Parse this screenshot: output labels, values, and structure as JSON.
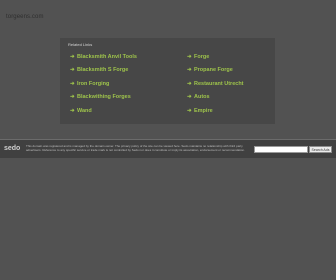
{
  "header": {
    "domain": "torgeens.com"
  },
  "related_links": {
    "heading": "Related Links",
    "arrow_icon": "right-arrow-icon",
    "items": [
      {
        "label": "Blacksmith Anvil Tools"
      },
      {
        "label": "Forge"
      },
      {
        "label": "Blacksmith S Forge"
      },
      {
        "label": "Propane Forge"
      },
      {
        "label": "Iron Forging"
      },
      {
        "label": "Restaurant Utrecht"
      },
      {
        "label": "Blackwithing Forges"
      },
      {
        "label": "Autos"
      },
      {
        "label": "Wand"
      },
      {
        "label": "Empire"
      }
    ]
  },
  "footer": {
    "logo": "sedo",
    "text": "This domain was registered and is managed by the domain owner. The privacy policy of the site can be viewed here. Sedo maintains no relationship with third party advertisers. Reference to any specific service or trade mark is not controlled by Sedo nor does it constitute or imply its association, endorsement or recommendation.",
    "search_placeholder": "",
    "search_button_label": "Search Ads"
  },
  "colors": {
    "background": "#525252",
    "panel": "#474747",
    "link_green": "#9ec34b",
    "footer_bg": "#404040"
  }
}
